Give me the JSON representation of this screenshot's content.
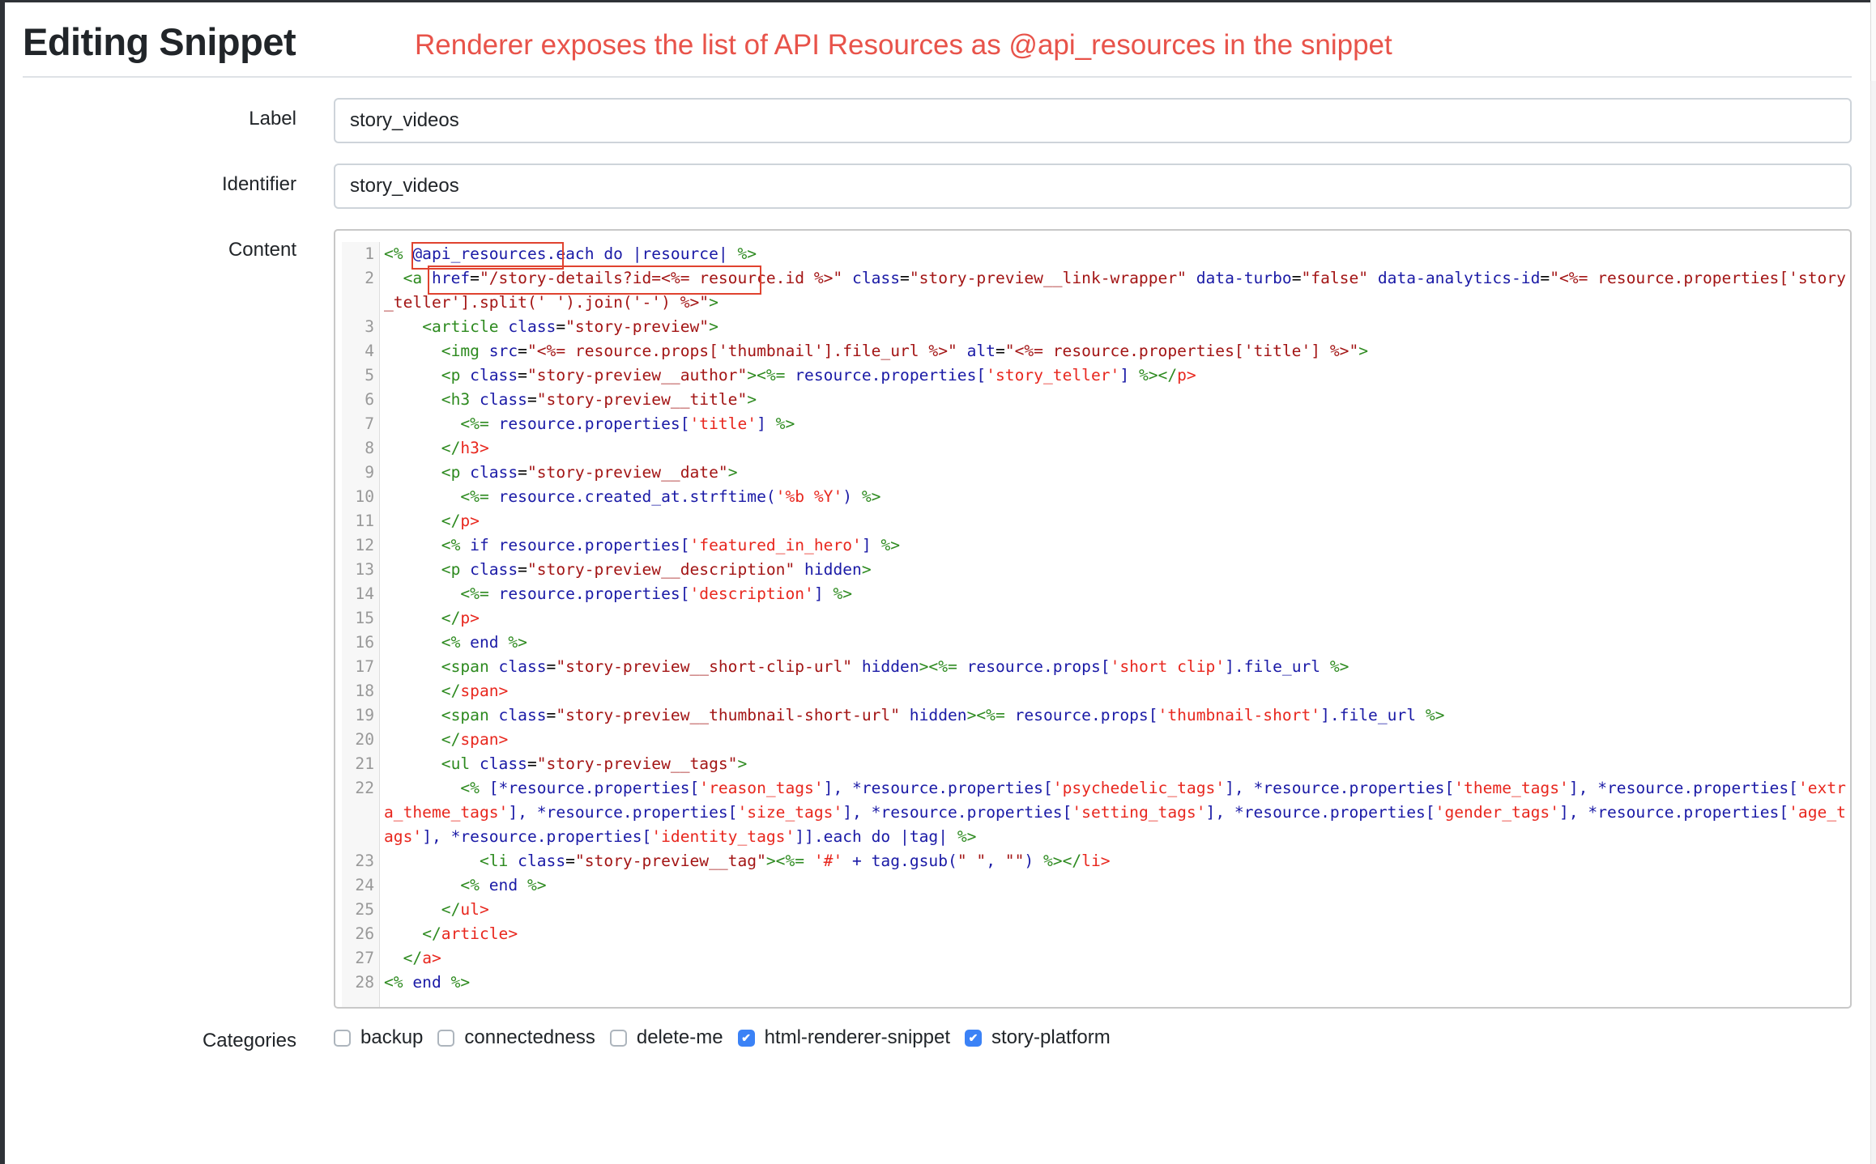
{
  "header": {
    "title": "Editing Snippet",
    "annotation": "Renderer exposes the list of API Resources as @api_resources in the snippet"
  },
  "form": {
    "label": {
      "label": "Label",
      "value": "story_videos"
    },
    "identifier": {
      "label": "Identifier",
      "value": "story_videos"
    },
    "content": {
      "label": "Content"
    },
    "categories": {
      "label": "Categories",
      "items": [
        {
          "name": "backup",
          "checked": false
        },
        {
          "name": "connectedness",
          "checked": false
        },
        {
          "name": "delete-me",
          "checked": false
        },
        {
          "name": "html-renderer-snippet",
          "checked": true
        },
        {
          "name": "story-platform",
          "checked": true
        }
      ]
    }
  },
  "code_lines": [
    {
      "n": "1",
      "tokens": [
        [
          "g",
          "<%"
        ],
        [
          "k",
          " "
        ],
        [
          "b",
          "@api_resources.each do |resource| "
        ],
        [
          "g",
          "%>"
        ]
      ]
    },
    {
      "n": "2",
      "tokens": [
        [
          "k",
          "  "
        ],
        [
          "g",
          "<a"
        ],
        [
          "b",
          " href"
        ],
        [
          "k",
          "="
        ],
        [
          "s",
          "\"/story-details?id=<%= resource.id %>\""
        ],
        [
          "b",
          " class"
        ],
        [
          "k",
          "="
        ],
        [
          "s",
          "\"story-preview__link-wrapper\""
        ],
        [
          "b",
          " data-turbo"
        ],
        [
          "k",
          "="
        ],
        [
          "s",
          "\"false\""
        ],
        [
          "b",
          " data-analytics-id"
        ],
        [
          "k",
          "="
        ],
        [
          "s",
          "\"<%= resource.properties['story_teller'].split(' ').join('-') %>\""
        ],
        [
          "g",
          ">"
        ]
      ]
    },
    {
      "n": "3",
      "tokens": [
        [
          "k",
          "    "
        ],
        [
          "g",
          "<article"
        ],
        [
          "b",
          " class"
        ],
        [
          "k",
          "="
        ],
        [
          "s",
          "\"story-preview\""
        ],
        [
          "g",
          ">"
        ]
      ]
    },
    {
      "n": "4",
      "tokens": [
        [
          "k",
          "      "
        ],
        [
          "g",
          "<img"
        ],
        [
          "b",
          " src"
        ],
        [
          "k",
          "="
        ],
        [
          "s",
          "\"<%= resource.props['thumbnail'].file_url %>\""
        ],
        [
          "b",
          " alt"
        ],
        [
          "k",
          "="
        ],
        [
          "s",
          "\"<%= resource.properties['title'] %>\""
        ],
        [
          "g",
          ">"
        ]
      ]
    },
    {
      "n": "5",
      "tokens": [
        [
          "k",
          "      "
        ],
        [
          "g",
          "<p"
        ],
        [
          "b",
          " class"
        ],
        [
          "k",
          "="
        ],
        [
          "s",
          "\"story-preview__author\""
        ],
        [
          "g",
          ">"
        ],
        [
          "g",
          "<%="
        ],
        [
          "b",
          " resource.properties["
        ],
        [
          "r",
          "'story_teller'"
        ],
        [
          "b",
          "] "
        ],
        [
          "g",
          "%>"
        ],
        [
          "g",
          "</"
        ],
        [
          "r",
          "p>"
        ]
      ]
    },
    {
      "n": "6",
      "tokens": [
        [
          "k",
          "      "
        ],
        [
          "g",
          "<h3"
        ],
        [
          "b",
          " class"
        ],
        [
          "k",
          "="
        ],
        [
          "s",
          "\"story-preview__title\""
        ],
        [
          "g",
          ">"
        ]
      ]
    },
    {
      "n": "7",
      "tokens": [
        [
          "k",
          "        "
        ],
        [
          "g",
          "<%="
        ],
        [
          "b",
          " resource.properties["
        ],
        [
          "r",
          "'title'"
        ],
        [
          "b",
          "] "
        ],
        [
          "g",
          "%>"
        ]
      ]
    },
    {
      "n": "8",
      "tokens": [
        [
          "k",
          "      "
        ],
        [
          "g",
          "</"
        ],
        [
          "r",
          "h3>"
        ]
      ]
    },
    {
      "n": "9",
      "tokens": [
        [
          "k",
          "      "
        ],
        [
          "g",
          "<p"
        ],
        [
          "b",
          " class"
        ],
        [
          "k",
          "="
        ],
        [
          "s",
          "\"story-preview__date\""
        ],
        [
          "g",
          ">"
        ]
      ]
    },
    {
      "n": "10",
      "tokens": [
        [
          "k",
          "        "
        ],
        [
          "g",
          "<%="
        ],
        [
          "b",
          " resource.created_at.strftime("
        ],
        [
          "r",
          "'%b %Y'"
        ],
        [
          "b",
          ") "
        ],
        [
          "g",
          "%>"
        ]
      ]
    },
    {
      "n": "11",
      "tokens": [
        [
          "k",
          "      "
        ],
        [
          "g",
          "</"
        ],
        [
          "r",
          "p>"
        ]
      ]
    },
    {
      "n": "12",
      "tokens": [
        [
          "k",
          "      "
        ],
        [
          "g",
          "<%"
        ],
        [
          "b",
          " if resource.properties["
        ],
        [
          "r",
          "'featured_in_hero'"
        ],
        [
          "b",
          "] "
        ],
        [
          "g",
          "%>"
        ]
      ]
    },
    {
      "n": "13",
      "tokens": [
        [
          "k",
          "      "
        ],
        [
          "g",
          "<p"
        ],
        [
          "b",
          " class"
        ],
        [
          "k",
          "="
        ],
        [
          "s",
          "\"story-preview__description\""
        ],
        [
          "b",
          " hidden"
        ],
        [
          "g",
          ">"
        ]
      ]
    },
    {
      "n": "14",
      "tokens": [
        [
          "k",
          "        "
        ],
        [
          "g",
          "<%="
        ],
        [
          "b",
          " resource.properties["
        ],
        [
          "r",
          "'description'"
        ],
        [
          "b",
          "] "
        ],
        [
          "g",
          "%>"
        ]
      ]
    },
    {
      "n": "15",
      "tokens": [
        [
          "k",
          "      "
        ],
        [
          "g",
          "</"
        ],
        [
          "r",
          "p>"
        ]
      ]
    },
    {
      "n": "16",
      "tokens": [
        [
          "k",
          "      "
        ],
        [
          "g",
          "<%"
        ],
        [
          "b",
          " end "
        ],
        [
          "g",
          "%>"
        ]
      ]
    },
    {
      "n": "17",
      "tokens": [
        [
          "k",
          "      "
        ],
        [
          "g",
          "<span"
        ],
        [
          "b",
          " class"
        ],
        [
          "k",
          "="
        ],
        [
          "s",
          "\"story-preview__short-clip-url\""
        ],
        [
          "b",
          " hidden"
        ],
        [
          "g",
          ">"
        ],
        [
          "g",
          "<%="
        ],
        [
          "b",
          " resource.props["
        ],
        [
          "r",
          "'short clip'"
        ],
        [
          "b",
          "].file_url "
        ],
        [
          "g",
          "%>"
        ]
      ]
    },
    {
      "n": "18",
      "tokens": [
        [
          "k",
          "      "
        ],
        [
          "g",
          "</"
        ],
        [
          "r",
          "span>"
        ]
      ]
    },
    {
      "n": "19",
      "tokens": [
        [
          "k",
          "      "
        ],
        [
          "g",
          "<span"
        ],
        [
          "b",
          " class"
        ],
        [
          "k",
          "="
        ],
        [
          "s",
          "\"story-preview__thumbnail-short-url\""
        ],
        [
          "b",
          " hidden"
        ],
        [
          "g",
          ">"
        ],
        [
          "g",
          "<%="
        ],
        [
          "b",
          " resource.props["
        ],
        [
          "r",
          "'thumbnail-short'"
        ],
        [
          "b",
          "].file_url "
        ],
        [
          "g",
          "%>"
        ]
      ]
    },
    {
      "n": "20",
      "tokens": [
        [
          "k",
          "      "
        ],
        [
          "g",
          "</"
        ],
        [
          "r",
          "span>"
        ]
      ]
    },
    {
      "n": "21",
      "tokens": [
        [
          "k",
          "      "
        ],
        [
          "g",
          "<ul"
        ],
        [
          "b",
          " class"
        ],
        [
          "k",
          "="
        ],
        [
          "s",
          "\"story-preview__tags\""
        ],
        [
          "g",
          ">"
        ]
      ]
    },
    {
      "n": "22",
      "tokens": [
        [
          "k",
          "        "
        ],
        [
          "g",
          "<%"
        ],
        [
          "b",
          " [*resource.properties["
        ],
        [
          "r",
          "'reason_tags'"
        ],
        [
          "b",
          "], *resource.properties["
        ],
        [
          "r",
          "'psychedelic_tags'"
        ],
        [
          "b",
          "], *resource.properties["
        ],
        [
          "r",
          "'theme_tags'"
        ],
        [
          "b",
          "], *resource.properties["
        ],
        [
          "r",
          "'extra_theme_tags'"
        ],
        [
          "b",
          "], *resource.properties["
        ],
        [
          "r",
          "'size_tags'"
        ],
        [
          "b",
          "], *resource.properties["
        ],
        [
          "r",
          "'setting_tags'"
        ],
        [
          "b",
          "], *resource.properties["
        ],
        [
          "r",
          "'gender_tags'"
        ],
        [
          "b",
          "], *resource.properties["
        ],
        [
          "r",
          "'age_tags'"
        ],
        [
          "b",
          "], *resource.properties["
        ],
        [
          "r",
          "'identity_tags'"
        ],
        [
          "b",
          "]].each do |tag| "
        ],
        [
          "g",
          "%>"
        ]
      ]
    },
    {
      "n": "23",
      "tokens": [
        [
          "k",
          "          "
        ],
        [
          "g",
          "<li"
        ],
        [
          "b",
          " class"
        ],
        [
          "k",
          "="
        ],
        [
          "s",
          "\"story-preview__tag\""
        ],
        [
          "g",
          ">"
        ],
        [
          "g",
          "<%="
        ],
        [
          "b",
          " "
        ],
        [
          "r",
          "'#'"
        ],
        [
          "b",
          " + tag.gsub("
        ],
        [
          "s",
          "\" \""
        ],
        [
          "b",
          ", "
        ],
        [
          "s",
          "\"\""
        ],
        [
          "b",
          ") "
        ],
        [
          "g",
          "%>"
        ],
        [
          "g",
          "</"
        ],
        [
          "r",
          "li>"
        ]
      ]
    },
    {
      "n": "24",
      "tokens": [
        [
          "k",
          "        "
        ],
        [
          "g",
          "<%"
        ],
        [
          "b",
          " end "
        ],
        [
          "g",
          "%>"
        ]
      ]
    },
    {
      "n": "25",
      "tokens": [
        [
          "k",
          "      "
        ],
        [
          "g",
          "</"
        ],
        [
          "r",
          "ul>"
        ]
      ]
    },
    {
      "n": "26",
      "tokens": [
        [
          "k",
          "    "
        ],
        [
          "g",
          "</"
        ],
        [
          "r",
          "article>"
        ]
      ]
    },
    {
      "n": "27",
      "tokens": [
        [
          "k",
          "  "
        ],
        [
          "g",
          "</"
        ],
        [
          "r",
          "a>"
        ]
      ]
    },
    {
      "n": "28",
      "tokens": [
        [
          "g",
          "<%"
        ],
        [
          "b",
          " end "
        ],
        [
          "g",
          "%>"
        ]
      ]
    }
  ],
  "colors": {
    "annotation": "#e8534a",
    "checkbox_checked": "#3b82f6",
    "highlight_box": "#e0432f"
  }
}
